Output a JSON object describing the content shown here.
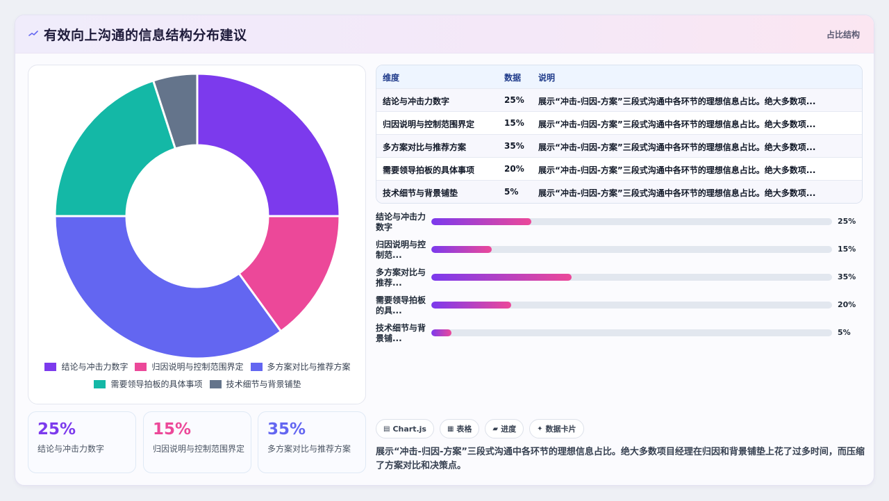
{
  "header": {
    "title": "有效向上沟通的信息结构分布建议",
    "right_label": "占比结构",
    "icon": "sparkline-icon"
  },
  "colors": {
    "violet": "#7c3aed",
    "pink": "#ec4899",
    "indigo": "#6366f1",
    "teal": "#14b8a6",
    "slate": "#64748b"
  },
  "chart_data": {
    "type": "pie",
    "variant": "doughnut",
    "categories": [
      "结论与冲击力数字",
      "归因说明与控制范围界定",
      "多方案对比与推荐方案",
      "需要领导拍板的具体事项",
      "技术细节与背景铺垫"
    ],
    "values": [
      25,
      15,
      35,
      20,
      5
    ],
    "colors": [
      "#7c3aed",
      "#ec4899",
      "#6366f1",
      "#14b8a6",
      "#64748b"
    ],
    "legend_position": "bottom"
  },
  "stats": [
    {
      "value": "25%",
      "label": "结论与冲击力数字",
      "color": "#7c3aed"
    },
    {
      "value": "15%",
      "label": "归因说明与控制范围界定",
      "color": "#ec4899"
    },
    {
      "value": "35%",
      "label": "多方案对比与推荐方案",
      "color": "#6366f1"
    }
  ],
  "table": {
    "headers": [
      "维度",
      "数据",
      "说明"
    ],
    "rows": [
      [
        "结论与冲击力数字",
        "25%",
        "展示“冲击-归因-方案”三段式沟通中各环节的理想信息占比。绝大多数项..."
      ],
      [
        "归因说明与控制范围界定",
        "15%",
        "展示“冲击-归因-方案”三段式沟通中各环节的理想信息占比。绝大多数项..."
      ],
      [
        "多方案对比与推荐方案",
        "35%",
        "展示“冲击-归因-方案”三段式沟通中各环节的理想信息占比。绝大多数项..."
      ],
      [
        "需要领导拍板的具体事项",
        "20%",
        "展示“冲击-归因-方案”三段式沟通中各环节的理想信息占比。绝大多数项..."
      ],
      [
        "技术细节与背景铺垫",
        "5%",
        "展示“冲击-归因-方案”三段式沟通中各环节的理想信息占比。绝大多数项..."
      ]
    ]
  },
  "progress": [
    {
      "label": "结论与冲击力数字",
      "value": 25,
      "value_label": "25%"
    },
    {
      "label": "归因说明与控制范...",
      "value": 15,
      "value_label": "15%"
    },
    {
      "label": "多方案对比与推荐...",
      "value": 35,
      "value_label": "35%"
    },
    {
      "label": "需要领导拍板的具...",
      "value": 20,
      "value_label": "20%"
    },
    {
      "label": "技术细节与背景铺...",
      "value": 5,
      "value_label": "5%"
    }
  ],
  "tags": [
    {
      "icon": "▤",
      "label": "Chart.js"
    },
    {
      "icon": "▦",
      "label": "表格"
    },
    {
      "icon": "▰",
      "label": "进度"
    },
    {
      "icon": "✦",
      "label": "数据卡片"
    }
  ],
  "description": "展示“冲击-归因-方案”三段式沟通中各环节的理想信息占比。绝大多数项目经理在归因和背景铺垫上花了过多时间，而压缩了方案对比和决策点。"
}
